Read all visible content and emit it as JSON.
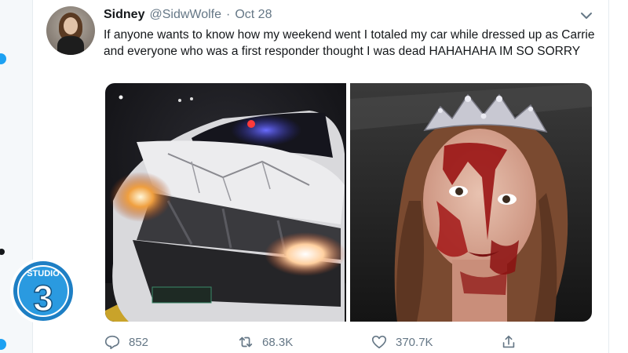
{
  "tweet": {
    "author_name": "Sidney",
    "author_handle": "@SidwWolfe",
    "separator": "·",
    "date": "Oct 28",
    "text": "If anyone wants to know how my weekend went I totaled my car while dressed up as Carrie and everyone who was a first responder thought I was dead HAHAHAHA IM SO SORRY",
    "images": [
      {
        "icon": "wrecked-car-photo"
      },
      {
        "icon": "carrie-costume-photo"
      }
    ]
  },
  "actions": {
    "replies": "852",
    "retweets": "68.3K",
    "likes": "370.7K",
    "reply_icon": "reply-icon",
    "retweet_icon": "retweet-icon",
    "like_icon": "heart-icon",
    "share_icon": "share-icon"
  },
  "overlay": {
    "logo_top": "STUDIO",
    "logo_number": "3"
  },
  "colors": {
    "accent": "#1da1f2",
    "secondary_text": "#657786",
    "primary_text": "#14171a"
  }
}
